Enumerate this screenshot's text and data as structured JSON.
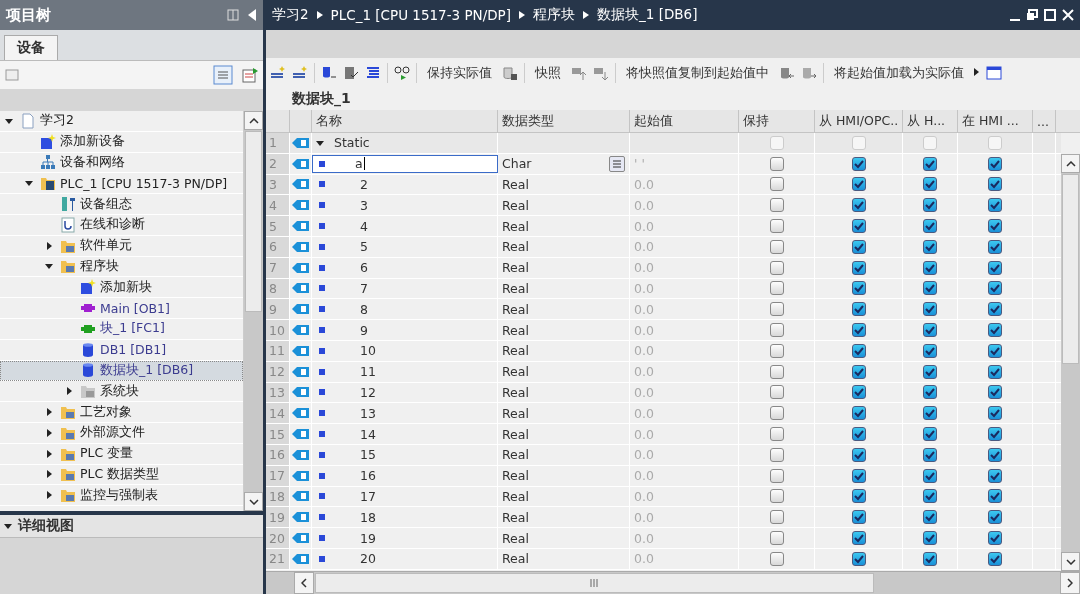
{
  "project_tree": {
    "title": "项目树",
    "tab": {
      "label": "设备",
      "selected": true
    },
    "items": [
      {
        "label": "学习2",
        "kind": "project",
        "expanded": true,
        "selected": false,
        "children": [
          {
            "label": "添加新设备",
            "kind": "add",
            "selected": false
          },
          {
            "label": "设备和网络",
            "kind": "network",
            "selected": false
          },
          {
            "label": "PLC_1 [CPU 1517-3 PN/DP]",
            "kind": "plc",
            "expanded": true,
            "selected": false,
            "children": [
              {
                "label": "设备组态",
                "kind": "config",
                "selected": false
              },
              {
                "label": "在线和诊断",
                "kind": "diag",
                "selected": false
              },
              {
                "label": "软件单元",
                "kind": "folder",
                "expanded": false,
                "selected": false
              },
              {
                "label": "程序块",
                "kind": "folder",
                "expanded": true,
                "selected": false,
                "children": [
                  {
                    "label": "添加新块",
                    "kind": "add",
                    "selected": false
                  },
                  {
                    "label": "Main [OB1]",
                    "kind": "ob",
                    "selected": false
                  },
                  {
                    "label": "块_1 [FC1]",
                    "kind": "fc",
                    "selected": false
                  },
                  {
                    "label": "DB1 [DB1]",
                    "kind": "db",
                    "selected": false
                  },
                  {
                    "label": "数据块_1 [DB6]",
                    "kind": "db",
                    "selected": true
                  },
                  {
                    "label": "系统块",
                    "kind": "sysfolder",
                    "expanded": false,
                    "selected": false
                  }
                ]
              },
              {
                "label": "工艺对象",
                "kind": "folder",
                "expanded": false,
                "selected": false
              },
              {
                "label": "外部源文件",
                "kind": "folder",
                "expanded": false,
                "selected": false
              },
              {
                "label": "PLC 变量",
                "kind": "folder",
                "expanded": false,
                "selected": false
              },
              {
                "label": "PLC 数据类型",
                "kind": "folder",
                "expanded": false,
                "selected": false
              },
              {
                "label": "监控与强制表",
                "kind": "folder",
                "expanded": false,
                "selected": false
              }
            ]
          }
        ]
      }
    ]
  },
  "detail_view": {
    "title": "详细视图",
    "expanded": true
  },
  "editor": {
    "breadcrumb": [
      "学习2",
      "PLC_1 [CPU 1517-3 PN/DP]",
      "程序块",
      "数据块_1 [DB6]"
    ],
    "toolbar": [
      "保持实际值",
      "快照",
      "将快照值复制到起始值中",
      "将起始值加载为实际值"
    ],
    "block_title": "数据块_1",
    "columns": [
      "名称",
      "数据类型",
      "起始值",
      "保持",
      "从 HMI/OPC..",
      "从 H...",
      "在 HMI ...",
      "..."
    ],
    "rows": [
      {
        "num": "1",
        "kind": "section",
        "expanded": true,
        "name": "Static",
        "datatype": "",
        "start": "",
        "retain": false,
        "hmi_access": false,
        "hmi_write": false,
        "hmi_visible": false
      },
      {
        "num": "2",
        "kind": "var",
        "editing": true,
        "name": "a",
        "datatype": "Char",
        "start": "' '",
        "retain": false,
        "hmi_access": true,
        "hmi_write": true,
        "hmi_visible": true
      },
      {
        "num": "3",
        "kind": "var",
        "editing": false,
        "name": "2",
        "datatype": "Real",
        "start": "0.0",
        "retain": false,
        "hmi_access": true,
        "hmi_write": true,
        "hmi_visible": true
      },
      {
        "num": "4",
        "kind": "var",
        "editing": false,
        "name": "3",
        "datatype": "Real",
        "start": "0.0",
        "retain": false,
        "hmi_access": true,
        "hmi_write": true,
        "hmi_visible": true
      },
      {
        "num": "5",
        "kind": "var",
        "editing": false,
        "name": "4",
        "datatype": "Real",
        "start": "0.0",
        "retain": false,
        "hmi_access": true,
        "hmi_write": true,
        "hmi_visible": true
      },
      {
        "num": "6",
        "kind": "var",
        "editing": false,
        "name": "5",
        "datatype": "Real",
        "start": "0.0",
        "retain": false,
        "hmi_access": true,
        "hmi_write": true,
        "hmi_visible": true
      },
      {
        "num": "7",
        "kind": "var",
        "editing": false,
        "name": "6",
        "datatype": "Real",
        "start": "0.0",
        "retain": false,
        "hmi_access": true,
        "hmi_write": true,
        "hmi_visible": true
      },
      {
        "num": "8",
        "kind": "var",
        "editing": false,
        "name": "7",
        "datatype": "Real",
        "start": "0.0",
        "retain": false,
        "hmi_access": true,
        "hmi_write": true,
        "hmi_visible": true
      },
      {
        "num": "9",
        "kind": "var",
        "editing": false,
        "name": "8",
        "datatype": "Real",
        "start": "0.0",
        "retain": false,
        "hmi_access": true,
        "hmi_write": true,
        "hmi_visible": true
      },
      {
        "num": "10",
        "kind": "var",
        "editing": false,
        "name": "9",
        "datatype": "Real",
        "start": "0.0",
        "retain": false,
        "hmi_access": true,
        "hmi_write": true,
        "hmi_visible": true
      },
      {
        "num": "11",
        "kind": "var",
        "editing": false,
        "name": "10",
        "datatype": "Real",
        "start": "0.0",
        "retain": false,
        "hmi_access": true,
        "hmi_write": true,
        "hmi_visible": true
      },
      {
        "num": "12",
        "kind": "var",
        "editing": false,
        "name": "11",
        "datatype": "Real",
        "start": "0.0",
        "retain": false,
        "hmi_access": true,
        "hmi_write": true,
        "hmi_visible": true
      },
      {
        "num": "13",
        "kind": "var",
        "editing": false,
        "name": "12",
        "datatype": "Real",
        "start": "0.0",
        "retain": false,
        "hmi_access": true,
        "hmi_write": true,
        "hmi_visible": true
      },
      {
        "num": "14",
        "kind": "var",
        "editing": false,
        "name": "13",
        "datatype": "Real",
        "start": "0.0",
        "retain": false,
        "hmi_access": true,
        "hmi_write": true,
        "hmi_visible": true
      },
      {
        "num": "15",
        "kind": "var",
        "editing": false,
        "name": "14",
        "datatype": "Real",
        "start": "0.0",
        "retain": false,
        "hmi_access": true,
        "hmi_write": true,
        "hmi_visible": true
      },
      {
        "num": "16",
        "kind": "var",
        "editing": false,
        "name": "15",
        "datatype": "Real",
        "start": "0.0",
        "retain": false,
        "hmi_access": true,
        "hmi_write": true,
        "hmi_visible": true
      },
      {
        "num": "17",
        "kind": "var",
        "editing": false,
        "name": "16",
        "datatype": "Real",
        "start": "0.0",
        "retain": false,
        "hmi_access": true,
        "hmi_write": true,
        "hmi_visible": true
      },
      {
        "num": "18",
        "kind": "var",
        "editing": false,
        "name": "17",
        "datatype": "Real",
        "start": "0.0",
        "retain": false,
        "hmi_access": true,
        "hmi_write": true,
        "hmi_visible": true
      },
      {
        "num": "19",
        "kind": "var",
        "editing": false,
        "name": "18",
        "datatype": "Real",
        "start": "0.0",
        "retain": false,
        "hmi_access": true,
        "hmi_write": true,
        "hmi_visible": true
      },
      {
        "num": "20",
        "kind": "var",
        "editing": false,
        "name": "19",
        "datatype": "Real",
        "start": "0.0",
        "retain": false,
        "hmi_access": true,
        "hmi_write": true,
        "hmi_visible": true
      },
      {
        "num": "21",
        "kind": "var",
        "editing": false,
        "name": "20",
        "datatype": "Real",
        "start": "0.0",
        "retain": false,
        "hmi_access": true,
        "hmi_write": true,
        "hmi_visible": true
      }
    ]
  }
}
